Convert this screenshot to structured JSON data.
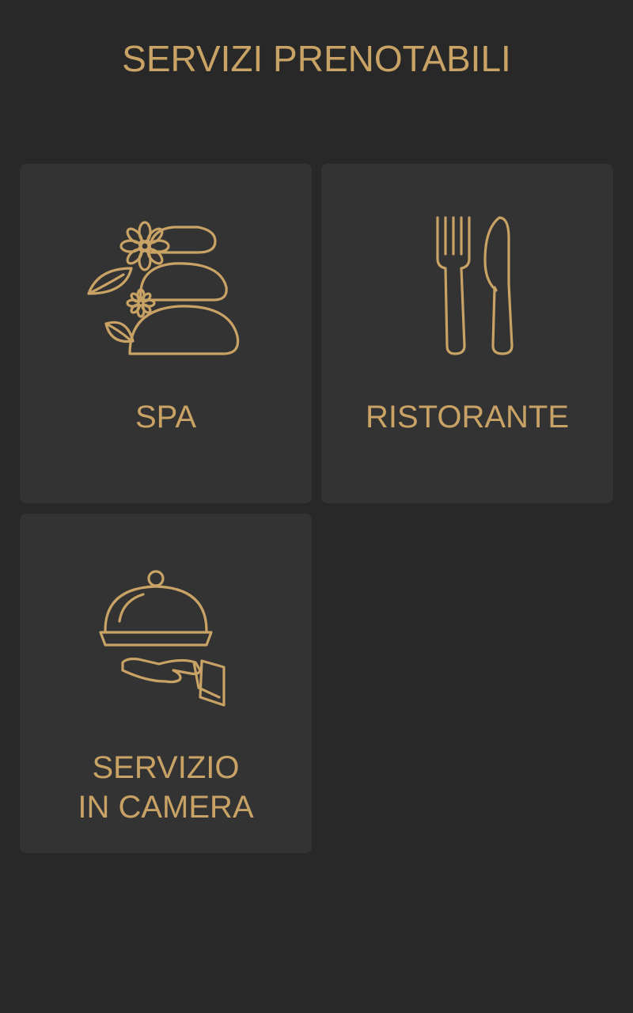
{
  "header": {
    "title": "SERVIZI PRENOTABILI"
  },
  "theme": {
    "background": "#282828",
    "card": "#333333",
    "accent": "#c9a265"
  },
  "services": [
    {
      "label": "SPA",
      "icon": "spa-stones-icon"
    },
    {
      "label": "RISTORANTE",
      "icon": "fork-knife-icon"
    },
    {
      "label_line1": "SERVIZIO",
      "label_line2": "IN CAMERA",
      "icon": "room-service-cloche-icon"
    }
  ]
}
